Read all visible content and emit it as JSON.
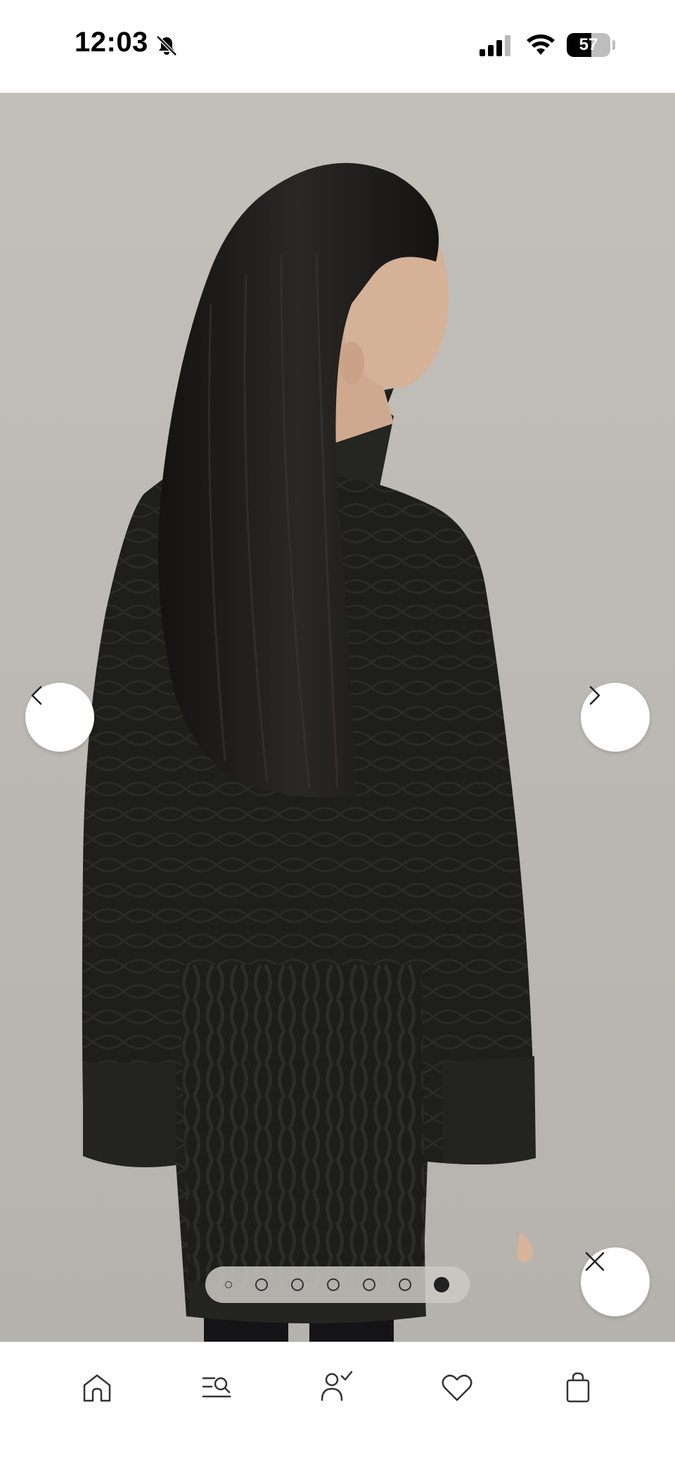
{
  "status_bar": {
    "time": "12:03",
    "battery": "57",
    "battery_level": 0.57
  },
  "gallery": {
    "image_count": 7,
    "active_index": 6,
    "icons": {
      "prev": "chevron-left-icon",
      "next": "chevron-right-icon",
      "close": "close-icon"
    }
  },
  "bottom_nav": {
    "items": [
      {
        "icon": "home-icon"
      },
      {
        "icon": "search-menu-icon"
      },
      {
        "icon": "account-icon"
      },
      {
        "icon": "heart-icon"
      },
      {
        "icon": "shopping-bag-icon"
      }
    ]
  },
  "colors": {
    "background": "#ffffff",
    "photo_backdrop": "#bdb9b4",
    "sweater": "#1c1c19",
    "icon": "#333333"
  }
}
